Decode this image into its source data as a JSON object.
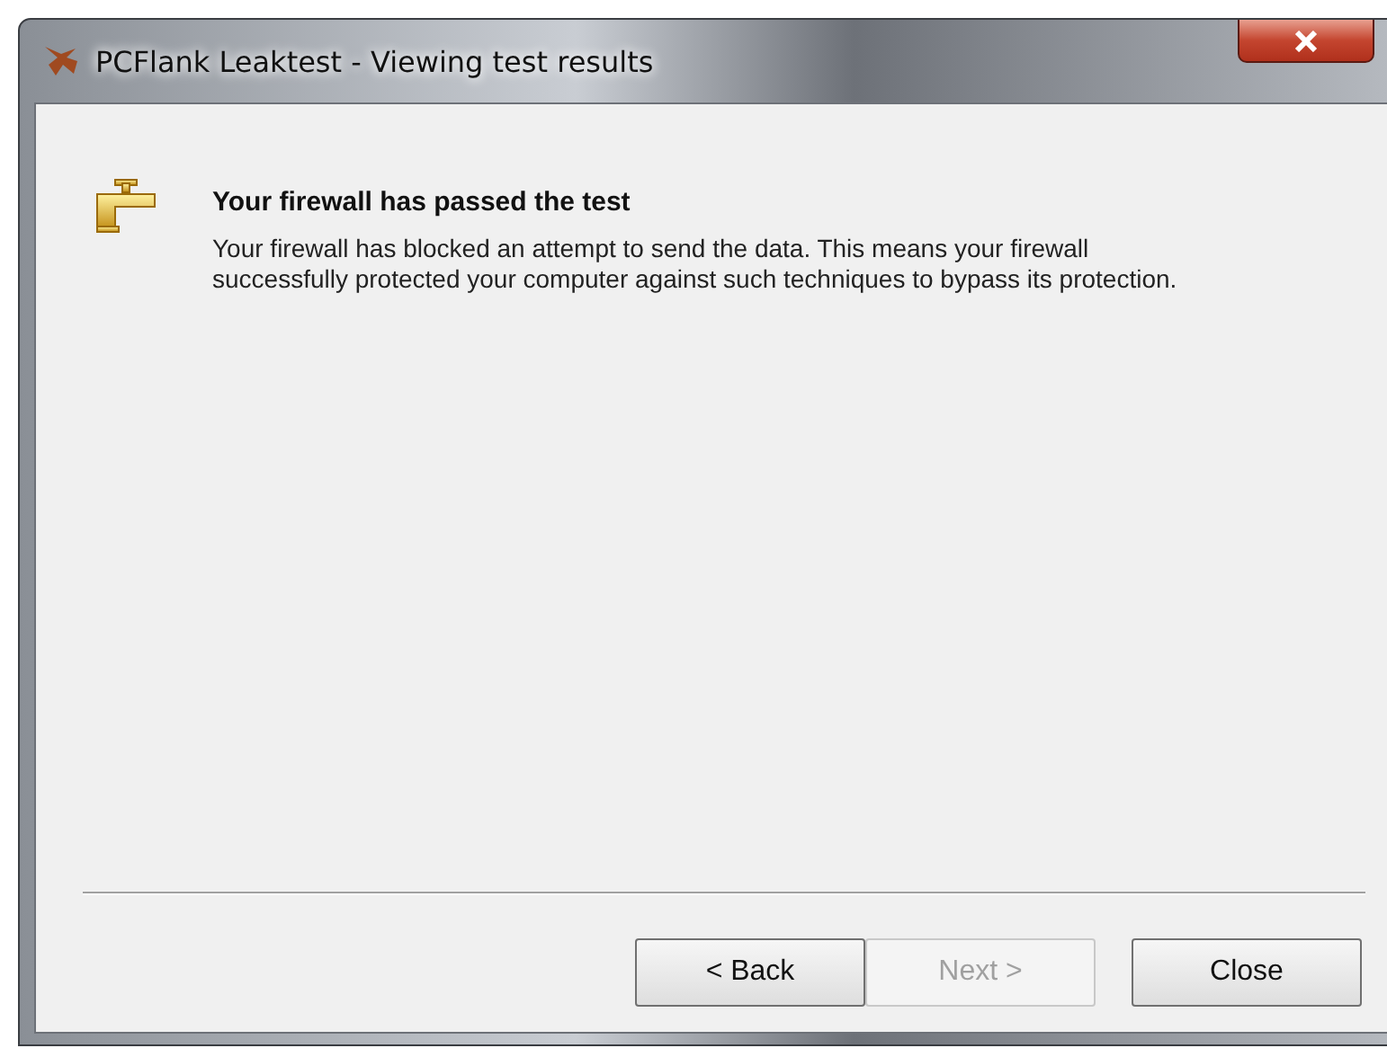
{
  "window": {
    "title": "PCFlank Leaktest - Viewing test results"
  },
  "result": {
    "heading": "Your firewall has passed the test",
    "message": "Your firewall has blocked an attempt to send the data. This means your firewall successfully protected your computer against such techniques to bypass its protection."
  },
  "buttons": [
    {
      "label": "< Back",
      "disabled": false
    },
    {
      "label": "Next >",
      "disabled": true
    },
    {
      "label": "Close",
      "disabled": false
    }
  ]
}
